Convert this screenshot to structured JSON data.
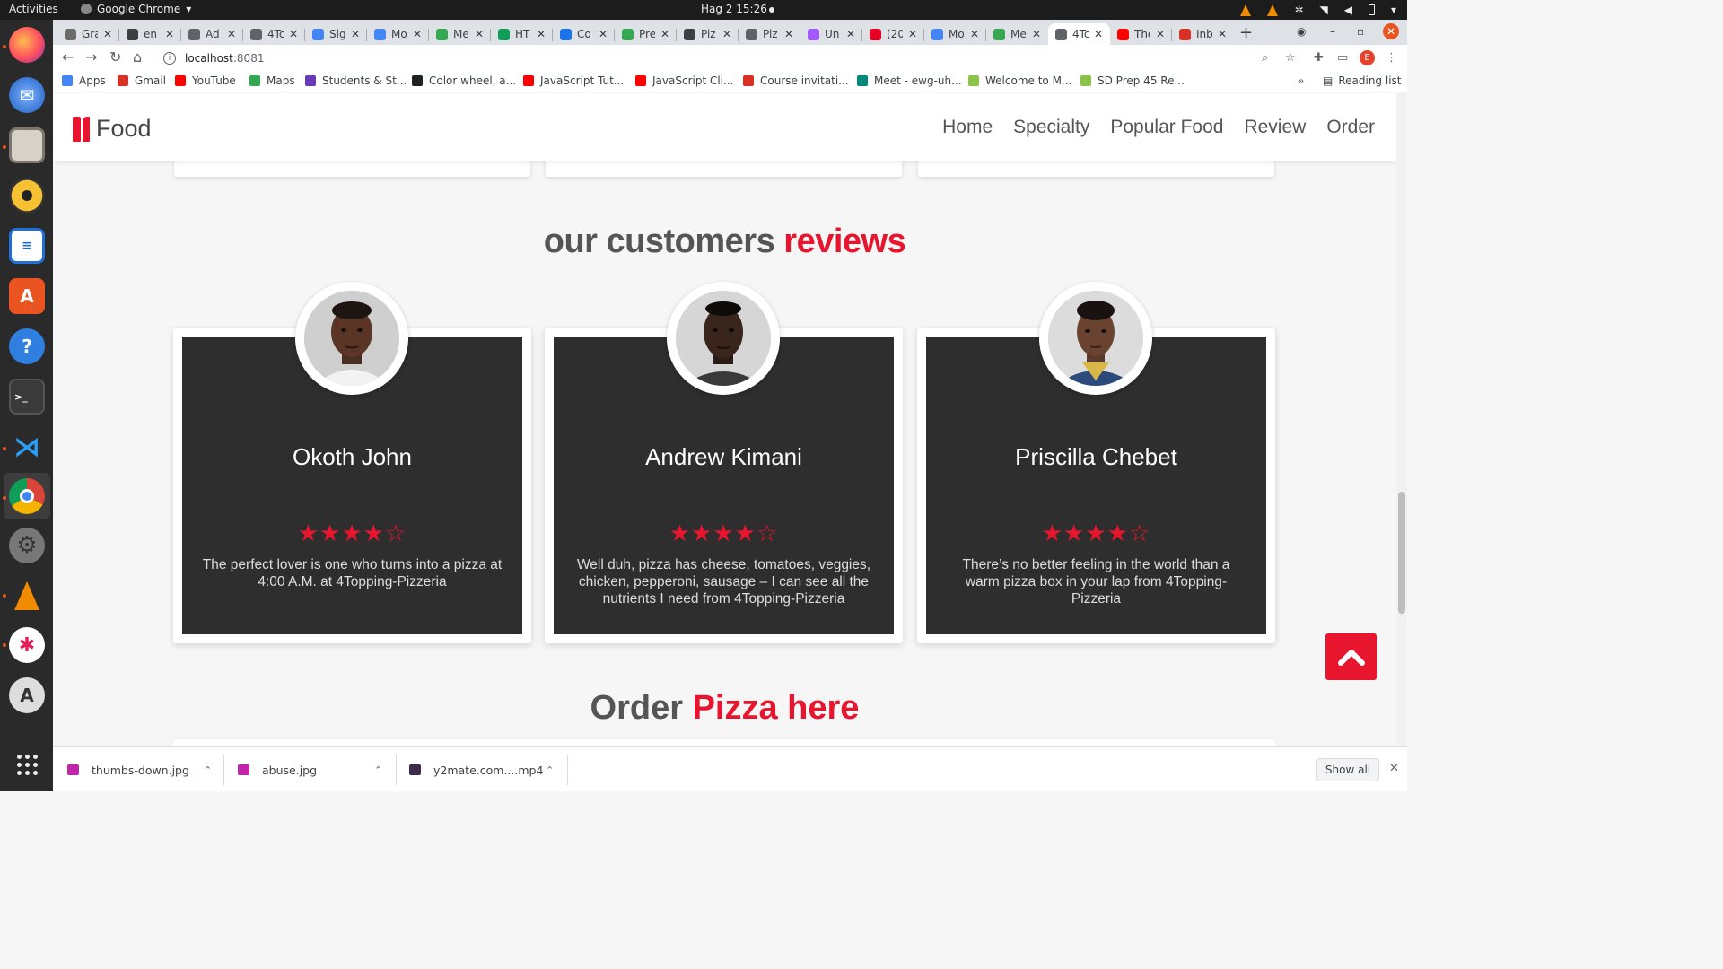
{
  "system_bar": {
    "activities": "Activities",
    "app_name": "Google Chrome",
    "clock": "Hag 2  15:26"
  },
  "dock": {
    "items": [
      "firefox-icon",
      "thunderbird-icon",
      "files-icon",
      "rhythmbox-icon",
      "writer-icon",
      "software-center-icon",
      "help-icon",
      "terminal-icon",
      "vscode-icon",
      "chrome-icon",
      "settings-icon",
      "vlc-icon",
      "slack-icon",
      "updater-icon",
      "show-apps-icon"
    ]
  },
  "tabs": [
    {
      "label": "Gra",
      "color": "#6b6b6b"
    },
    {
      "label": "en",
      "color": "#3c4043"
    },
    {
      "label": "Ad",
      "color": "#5f6368"
    },
    {
      "label": "4Tc",
      "color": "#5f6368"
    },
    {
      "label": "Sig",
      "color": "#4285f4"
    },
    {
      "label": "Mo",
      "color": "#4285f4"
    },
    {
      "label": "Me",
      "color": "#34a853"
    },
    {
      "label": "HT",
      "color": "#0f9d58"
    },
    {
      "label": "Co",
      "color": "#1a73e8"
    },
    {
      "label": "Pre",
      "color": "#34a853"
    },
    {
      "label": "Piz",
      "color": "#3c4043"
    },
    {
      "label": "Piz",
      "color": "#5f6368"
    },
    {
      "label": "Un",
      "color": "#a259ff"
    },
    {
      "label": "(20",
      "color": "#e60023"
    },
    {
      "label": "Mo",
      "color": "#4285f4"
    },
    {
      "label": "Me",
      "color": "#34a853"
    },
    {
      "label": "4Tc",
      "color": "#5f6368",
      "active": true
    },
    {
      "label": "The",
      "color": "#ff0000"
    },
    {
      "label": "Inb",
      "color": "#d93025"
    }
  ],
  "address_bar": {
    "host": "localhost",
    "port": ":8081"
  },
  "bookmarks": [
    {
      "label": "Apps",
      "color": "#4285f4"
    },
    {
      "label": "Gmail",
      "color": "#d93025"
    },
    {
      "label": "YouTube",
      "color": "#ff0000"
    },
    {
      "label": "Maps",
      "color": "#34a853"
    },
    {
      "label": "Students & St...",
      "color": "#673ab7"
    },
    {
      "label": "Color wheel, a...",
      "color": "#202124"
    },
    {
      "label": "JavaScript Tut...",
      "color": "#ff0000"
    },
    {
      "label": "JavaScript Cli...",
      "color": "#ff0000"
    },
    {
      "label": "Course invitati...",
      "color": "#d93025"
    },
    {
      "label": "Meet - ewg-uh...",
      "color": "#00897b"
    },
    {
      "label": "Welcome to M...",
      "color": "#8bc34a"
    },
    {
      "label": "SD Prep 45 Re...",
      "color": "#8bc34a"
    }
  ],
  "reading_list": "Reading list",
  "site": {
    "brand": "Food",
    "nav": [
      "Home",
      "Specialty",
      "Popular Food",
      "Review",
      "Order"
    ],
    "reviews_title_main": "our customers ",
    "reviews_title_accent": "reviews",
    "reviews": [
      {
        "name": "Okoth John",
        "rating": 4,
        "text": "The perfect lover is one who turns into a pizza at 4:00 A.M. at 4Topping-Pizzeria"
      },
      {
        "name": "Andrew Kimani",
        "rating": 4,
        "text": "Well duh, pizza has cheese, tomatoes, veggies, chicken, pepperoni, sausage – I can see all the nutrients I need from 4Topping-Pizzeria"
      },
      {
        "name": "Priscilla Chebet",
        "rating": 4,
        "text": "There’s no better feeling in the world than a warm pizza box in your lap from 4Topping-Pizzeria"
      }
    ],
    "order_title_main": "Order ",
    "order_title_accent": "Pizza here",
    "accent_color": "#e8152e"
  },
  "downloads": {
    "items": [
      "thumbs-down.jpg",
      "abuse.jpg",
      "y2mate.com....mp4"
    ],
    "show_all": "Show all"
  }
}
